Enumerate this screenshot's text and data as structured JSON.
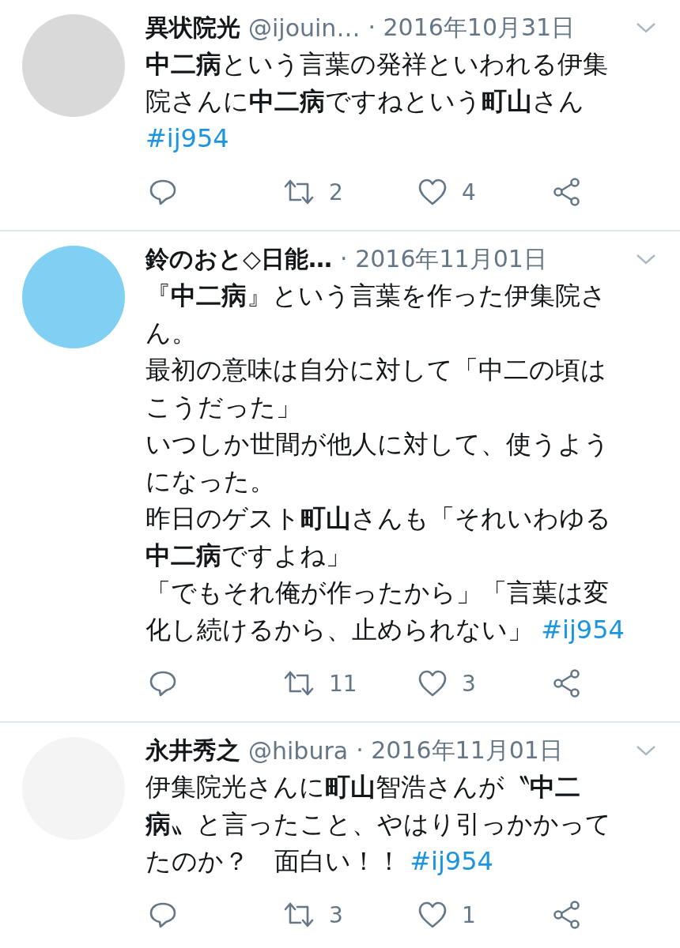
{
  "tweets": [
    {
      "name": "異状院光",
      "handle": "@ijouin…",
      "date": "· 2016年10月31日",
      "paragraphs": [
        "**中二病**という言葉の発祥といわれる伊集院さんに**中二病**ですねという**町山**さん "
      ],
      "hashtag": "#ij954",
      "retweets": "2",
      "likes": "4"
    },
    {
      "name": "鈴のおと◇日能…",
      "date": "· 2016年11月01日",
      "paragraphs": [
        "『**中二病**』という言葉を作った伊集院さん。",
        "最初の意味は自分に対して「中二の頃はこうだった」",
        "いつしか世間が他人に対して、使うようになった。",
        "昨日のゲスト**町山**さんも「それいわゆる**中二病**ですよね」",
        "「でもそれ俺が作ったから」「言葉は変化し続けるから、止められない」 "
      ],
      "hashtag": "#ij954",
      "retweets": "11",
      "likes": "3"
    },
    {
      "name": "永井秀之",
      "handle": "@hibura",
      "date": "· 2016年11月01日",
      "paragraphs": [
        "伊集院光さんに**町山**智浩さんが〝**中二病**〟と言ったこと、やはり引っかかってたのか？　面白い！！ "
      ],
      "hashtag": "#ij954",
      "retweets": "3",
      "likes": "1"
    }
  ]
}
